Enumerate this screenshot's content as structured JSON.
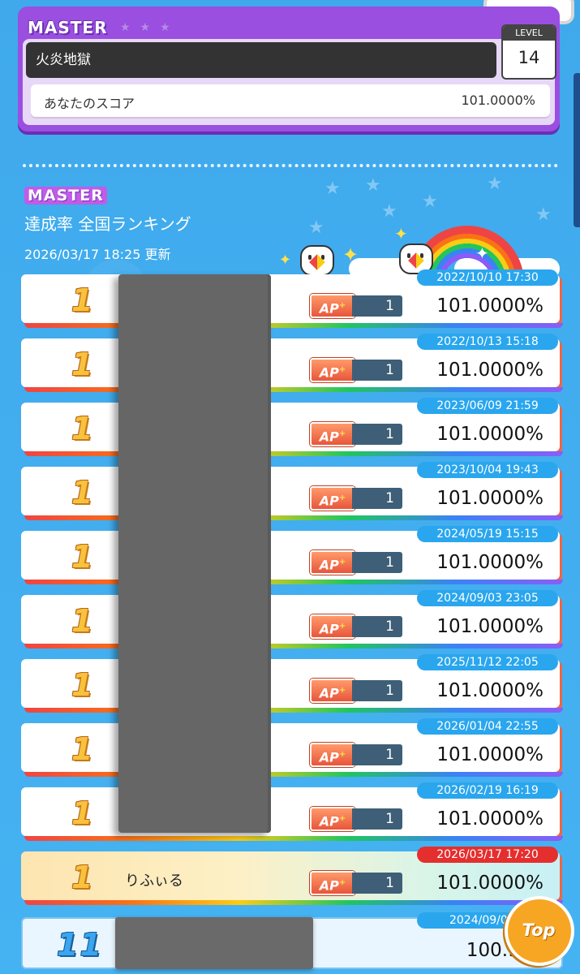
{
  "header": {
    "difficulty": "MASTER",
    "song_title": "火炎地獄",
    "level_label": "LEVEL",
    "level": "14",
    "your_score_label": "あなたのスコア",
    "your_score": "101.0000%"
  },
  "ranking": {
    "difficulty": "MASTER",
    "title": "達成率 全国ランキング",
    "updated": "2026/03/17 18:25 更新",
    "ap_label": "AP",
    "rows": [
      {
        "rank": "1",
        "name": "",
        "ap_count": "1",
        "timestamp": "2022/10/10 17:30",
        "score": "101.0000%"
      },
      {
        "rank": "1",
        "name": "",
        "ap_count": "1",
        "timestamp": "2022/10/13 15:18",
        "score": "101.0000%"
      },
      {
        "rank": "1",
        "name": "",
        "ap_count": "1",
        "timestamp": "2023/06/09 21:59",
        "score": "101.0000%"
      },
      {
        "rank": "1",
        "name": "",
        "ap_count": "1",
        "timestamp": "2023/10/04 19:43",
        "score": "101.0000%"
      },
      {
        "rank": "1",
        "name": "",
        "ap_count": "1",
        "timestamp": "2024/05/19 15:15",
        "score": "101.0000%"
      },
      {
        "rank": "1",
        "name": "",
        "ap_count": "1",
        "timestamp": "2024/09/03 23:05",
        "score": "101.0000%"
      },
      {
        "rank": "1",
        "name": "",
        "ap_count": "1",
        "timestamp": "2025/11/12 22:05",
        "score": "101.0000%"
      },
      {
        "rank": "1",
        "name": "",
        "ap_count": "1",
        "timestamp": "2026/01/04 22:55",
        "score": "101.0000%"
      },
      {
        "rank": "1",
        "name": "",
        "ap_count": "1",
        "timestamp": "2026/02/19 16:19",
        "score": "101.0000%"
      },
      {
        "rank": "1",
        "name": "りふぃる",
        "ap_count": "1",
        "timestamp": "2026/03/17 17:20",
        "score": "101.0000%",
        "self": true
      },
      {
        "rank": "11",
        "name": "",
        "timestamp": "2024/09/05 1",
        "score": "100.992"
      }
    ]
  },
  "top_button": "Top",
  "colors": {
    "background": "#41aef0",
    "master_purple": "#9a4fe0",
    "row_shadow": "#e8684a",
    "self_timestamp": "#e52e2e",
    "timestamp": "#2aa6ee"
  }
}
